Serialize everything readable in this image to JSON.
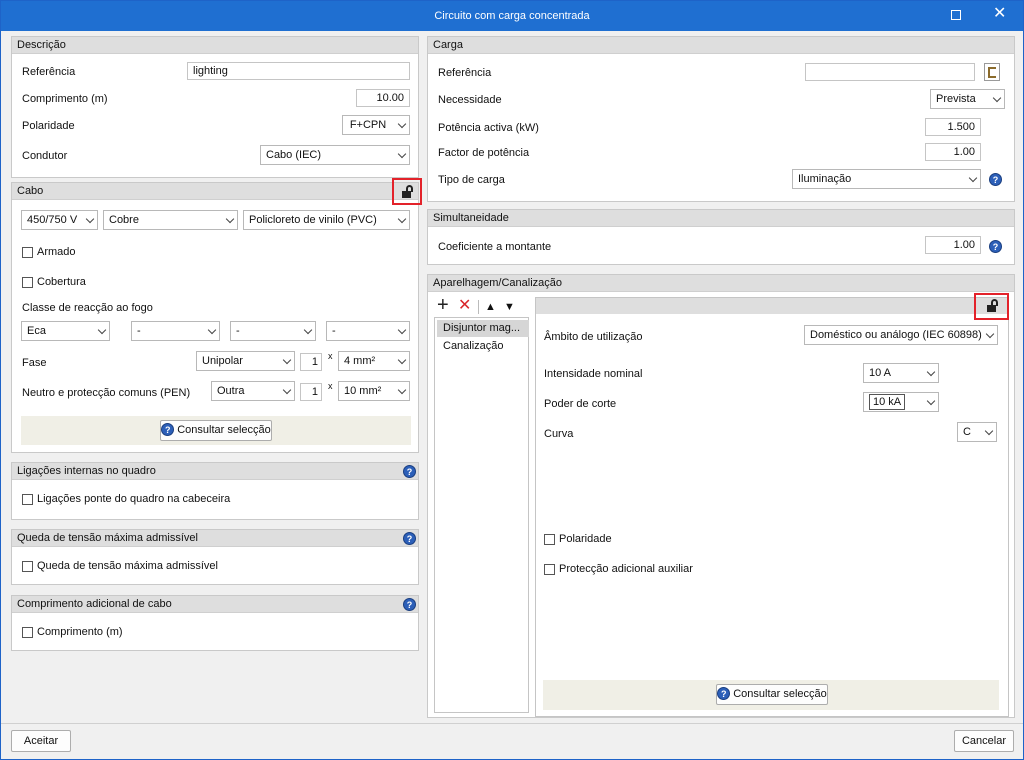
{
  "window": {
    "title": "Circuito com carga concentrada",
    "maximize_icon": "maximize-icon",
    "close_glyph": "✕"
  },
  "descricao": {
    "header": "Descrição",
    "referencia_label": "Referência",
    "referencia_value": "lighting",
    "comprimento_label": "Comprimento (m)",
    "comprimento_value": "10.00",
    "polaridade_label": "Polaridade",
    "polaridade_value": "F+CPN",
    "condutor_label": "Condutor",
    "condutor_value": "Cabo (IEC)"
  },
  "cabo": {
    "header": "Cabo",
    "tensao": "450/750 V",
    "material": "Cobre",
    "isolamento": "Policloreto de vinilo (PVC)",
    "armado_label": "Armado",
    "cobertura_label": "Cobertura",
    "classe_label": "Classe de reacção ao fogo",
    "classe_values": [
      "Eca",
      "-",
      "-",
      "-"
    ],
    "fase_label": "Fase",
    "fase_tipo": "Unipolar",
    "fase_qtd": "1",
    "fase_x": "x",
    "fase_secao": "4 mm²",
    "pen_label": "Neutro e protecção comuns (PEN)",
    "pen_tipo": "Outra",
    "pen_qtd": "1",
    "pen_x": "x",
    "pen_secao": "10 mm²",
    "consultar_label": "Consultar selecção"
  },
  "ligacoes": {
    "header": "Ligações internas no quadro",
    "check_label": "Ligações ponte do quadro na cabeceira"
  },
  "queda": {
    "header": "Queda de tensão máxima admissível",
    "check_label": "Queda de tensão máxima admissível"
  },
  "comprimento_adicional": {
    "header": "Comprimento adicional de cabo",
    "check_label": "Comprimento (m)"
  },
  "carga": {
    "header": "Carga",
    "referencia_label": "Referência",
    "referencia_value": "",
    "necessidade_label": "Necessidade",
    "necessidade_value": "Prevista",
    "potencia_label": "Potência activa (kW)",
    "potencia_value": "1.500",
    "factor_label": "Factor de potência",
    "factor_value": "1.00",
    "tipo_label": "Tipo de carga",
    "tipo_value": "Iluminação"
  },
  "simultaneidade": {
    "header": "Simultaneidade",
    "coef_label": "Coeficiente a montante",
    "coef_value": "1.00"
  },
  "aparelhagem": {
    "header": "Aparelhagem/Canalização",
    "toolbar": {
      "add": "+",
      "delete": "✕",
      "up": "▲",
      "down": "▼"
    },
    "list": [
      "Disjuntor mag...",
      "Canalização"
    ],
    "ambito_label": "Âmbito de utilização",
    "ambito_value": "Doméstico ou análogo (IEC 60898)",
    "intensidade_label": "Intensidade nominal",
    "intensidade_value": "10 A",
    "poder_label": "Poder de corte",
    "poder_value": "10 kA",
    "curva_label": "Curva",
    "curva_value": "C",
    "polaridade_label": "Polaridade",
    "proteccao_label": "Protecção adicional auxiliar",
    "consultar_label": "Consultar selecção"
  },
  "footer": {
    "aceitar": "Aceitar",
    "cancelar": "Cancelar"
  },
  "help_glyph": "?",
  "colors": {
    "titlebar": "#1f6fd1",
    "highlight": "#e3222a",
    "help": "#2c5fb8"
  }
}
